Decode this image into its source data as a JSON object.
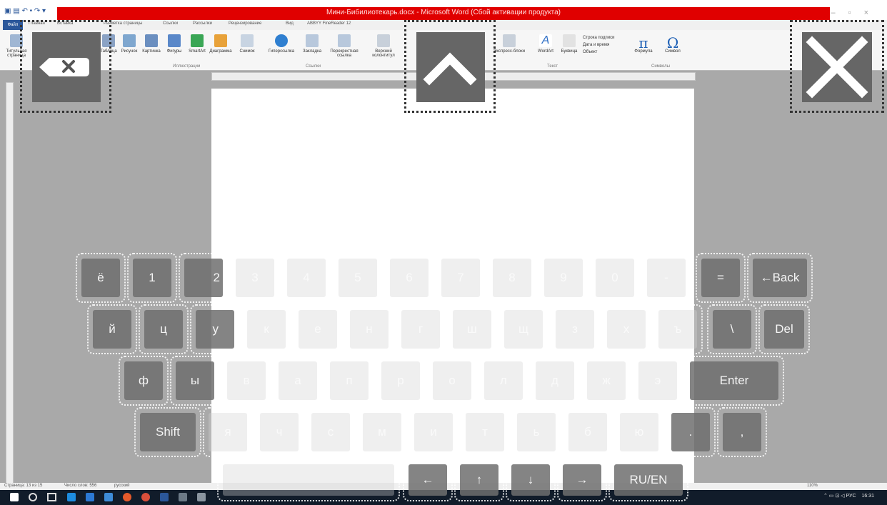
{
  "window": {
    "title": "Мини-Бибилиотекарь.docx - Microsoft Word (Сбой активации продукта)",
    "controls": [
      "–",
      "▫",
      "×"
    ]
  },
  "ribbon": {
    "tabs": [
      "Файл",
      "Главная",
      "Вставка",
      "Разметка страницы",
      "Ссылки",
      "Рассылки",
      "Рецензирование",
      "Вид",
      "ABBYY FineReader 12"
    ],
    "buttons": [
      "Титульная страница",
      "Таблица",
      "Рисунок",
      "Картинка",
      "Фигуры",
      "SmartArt",
      "Диаграмма",
      "Снимок",
      "Гиперссылка",
      "Закладка",
      "Перекрестная ссылка",
      "Верхний колонтитул",
      "Экспресс-блоки",
      "WordArt",
      "Буквица",
      "Формула",
      "Символ"
    ],
    "side_items": [
      "Строка подписи",
      "Дата и время",
      "Объект"
    ],
    "groups": [
      "Иллюстрации",
      "Ссылки",
      "Текст",
      "Символы"
    ]
  },
  "statusbar": {
    "page": "Страница: 13 из 15",
    "words": "Число слов: 556",
    "lang": "русский",
    "zoom": "110%"
  },
  "taskbar": {
    "tray_lang": "РУС",
    "time": "16:31"
  },
  "top_buttons": {
    "backspace": "backspace",
    "up": "up",
    "close": "close"
  },
  "keyboard": {
    "row1": [
      "ё",
      "1",
      "2",
      "3",
      "4",
      "5",
      "6",
      "7",
      "8",
      "9",
      "0",
      "-",
      "=",
      "←Back"
    ],
    "row2": [
      "й",
      "ц",
      "у",
      "к",
      "е",
      "н",
      "г",
      "ш",
      "щ",
      "з",
      "х",
      "ъ",
      "\\",
      "Del"
    ],
    "row3": [
      "ф",
      "ы",
      "в",
      "а",
      "п",
      "р",
      "о",
      "л",
      "д",
      "ж",
      "э",
      "Enter"
    ],
    "row4": [
      "Shift",
      "я",
      "ч",
      "с",
      "м",
      "и",
      "т",
      "ь",
      "б",
      "ю",
      ".",
      ","
    ],
    "row5": [
      "",
      "←",
      "↑",
      "↓",
      "→",
      "RU/EN"
    ]
  }
}
